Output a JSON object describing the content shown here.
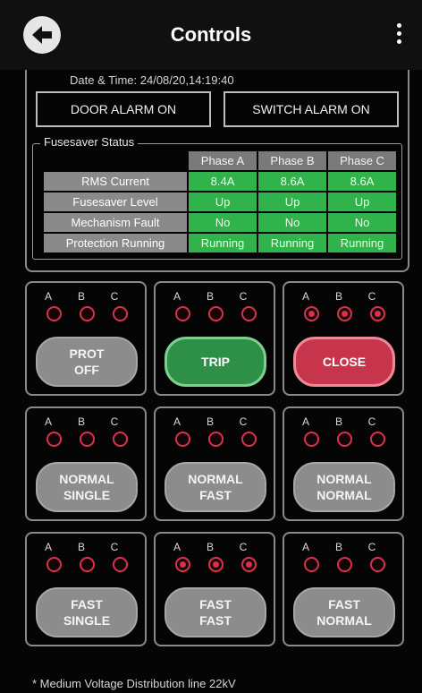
{
  "header": {
    "title": "Controls",
    "back_icon": "back-arrow-icon",
    "menu_icon": "overflow-menu-icon"
  },
  "status": {
    "datetime": "Date & Time: 24/08/20,14:19:40",
    "door_alarm": "DOOR ALARM ON",
    "switch_alarm": "SWITCH ALARM ON"
  },
  "fusesaver": {
    "legend": "Fusesaver Status",
    "columns": [
      "Phase A",
      "Phase B",
      "Phase C"
    ],
    "rows": [
      {
        "label": "RMS Current",
        "values": [
          "8.4A",
          "8.6A",
          "8.6A"
        ]
      },
      {
        "label": "Fusesaver Level",
        "values": [
          "Up",
          "Up",
          "Up"
        ]
      },
      {
        "label": "Mechanism Fault",
        "values": [
          "No",
          "No",
          "No"
        ]
      },
      {
        "label": "Protection Running",
        "values": [
          "Running",
          "Running",
          "Running"
        ]
      }
    ]
  },
  "phase_letters": [
    "A",
    "B",
    "C"
  ],
  "controls": [
    {
      "id": "prot-off",
      "label": "PROT\nOFF",
      "style": "grey",
      "leds": [
        false,
        false,
        false
      ]
    },
    {
      "id": "trip",
      "label": "TRIP",
      "style": "green",
      "leds": [
        false,
        false,
        false
      ]
    },
    {
      "id": "close",
      "label": "CLOSE",
      "style": "red",
      "leds": [
        true,
        true,
        true
      ]
    },
    {
      "id": "normal-single",
      "label": "NORMAL\nSINGLE",
      "style": "grey",
      "leds": [
        false,
        false,
        false
      ]
    },
    {
      "id": "normal-fast",
      "label": "NORMAL\nFAST",
      "style": "grey",
      "leds": [
        false,
        false,
        false
      ]
    },
    {
      "id": "normal-normal",
      "label": "NORMAL\nNORMAL",
      "style": "grey",
      "leds": [
        false,
        false,
        false
      ]
    },
    {
      "id": "fast-single",
      "label": "FAST\nSINGLE",
      "style": "grey",
      "leds": [
        false,
        false,
        false
      ]
    },
    {
      "id": "fast-fast",
      "label": "FAST\nFAST",
      "style": "grey",
      "leds": [
        true,
        true,
        true
      ]
    },
    {
      "id": "fast-normal",
      "label": "FAST\nNORMAL",
      "style": "grey",
      "leds": [
        false,
        false,
        false
      ]
    }
  ],
  "footnote": "* Medium Voltage Distribution line 22kV",
  "colors": {
    "background": "#050505",
    "status_green": "#2fb34a",
    "trip_green": "#2e8f47",
    "close_red": "#c6354b",
    "led_red": "#d9314a",
    "button_grey": "#8c8c8c"
  }
}
